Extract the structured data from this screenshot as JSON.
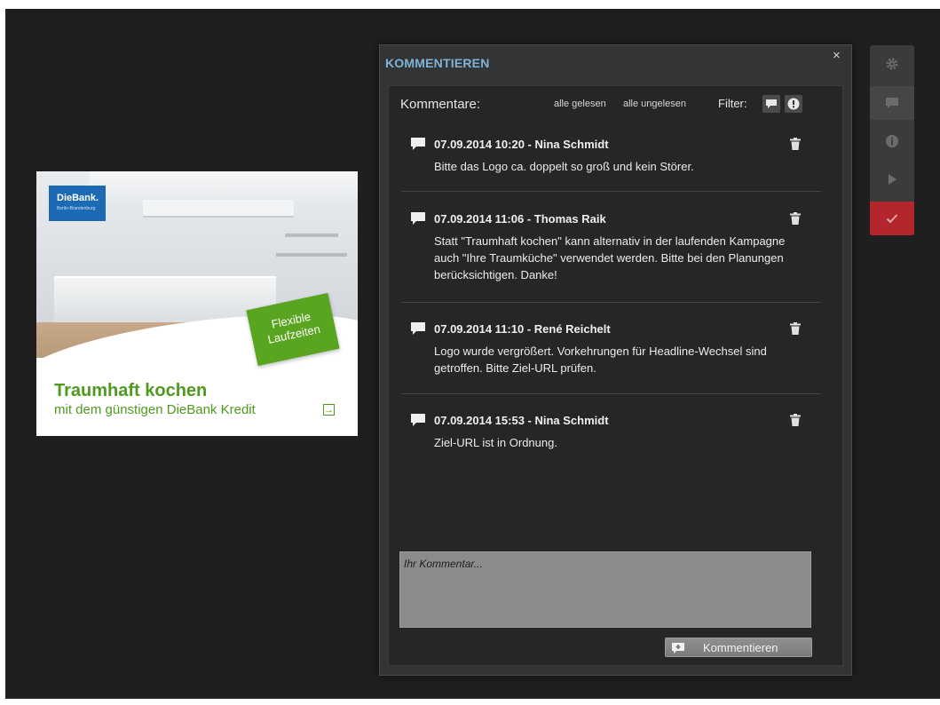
{
  "ad": {
    "logo_brand": "DieBank.",
    "logo_sub": "Berlin-Brandenburg",
    "badge_line1": "Flexible",
    "badge_line2": "Laufzeiten",
    "headline": "Traumhaft kochen",
    "subline": "mit dem günstigen DieBank Kredit",
    "arrow": "→",
    "colors": {
      "green": "#4e9a1f",
      "badge": "#5aa51f",
      "logo": "#1b6ab3"
    }
  },
  "panel": {
    "title": "KOMMENTIEREN",
    "close": "×",
    "header_label": "Kommentare:",
    "mark_all_read": "alle gelesen",
    "mark_all_unread": "alle ungelesen",
    "filter_label": "Filter:",
    "filter_icons": [
      "comment-icon",
      "alert-icon"
    ],
    "comments": [
      {
        "date": "07.09.2014  10:20 - Nina Schmidt",
        "text": "Bitte das Logo ca. doppelt so groß und kein Störer."
      },
      {
        "date": "07.09.2014  11:06 - Thomas Raik",
        "text": "Statt \"Traumhaft kochen\" kann alternativ in der laufenden Kampagne auch \"Ihre Traumküche\" verwendet werden. Bitte bei den Planungen berücksichtigen. Danke!"
      },
      {
        "date": "07.09.2014  11:10 - René Reichelt",
        "text": "Logo wurde vergrößert. Vorkehrungen für Headline-Wechsel sind getroffen. Bitte Ziel-URL prüfen."
      },
      {
        "date": "07.09.2014  15:53 - Nina Schmidt",
        "text": "Ziel-URL ist in Ordnung."
      }
    ],
    "input_placeholder": "Ihr Kommentar...",
    "submit_label": "Kommentieren",
    "colors": {
      "title": "#7fb3d8",
      "background": "#333435"
    }
  },
  "toolbar": {
    "items": [
      "settings-icon",
      "comment-icon",
      "info-icon",
      "play-icon",
      "check-icon"
    ],
    "active": "comment-icon",
    "approve_color": "#b3262b"
  }
}
